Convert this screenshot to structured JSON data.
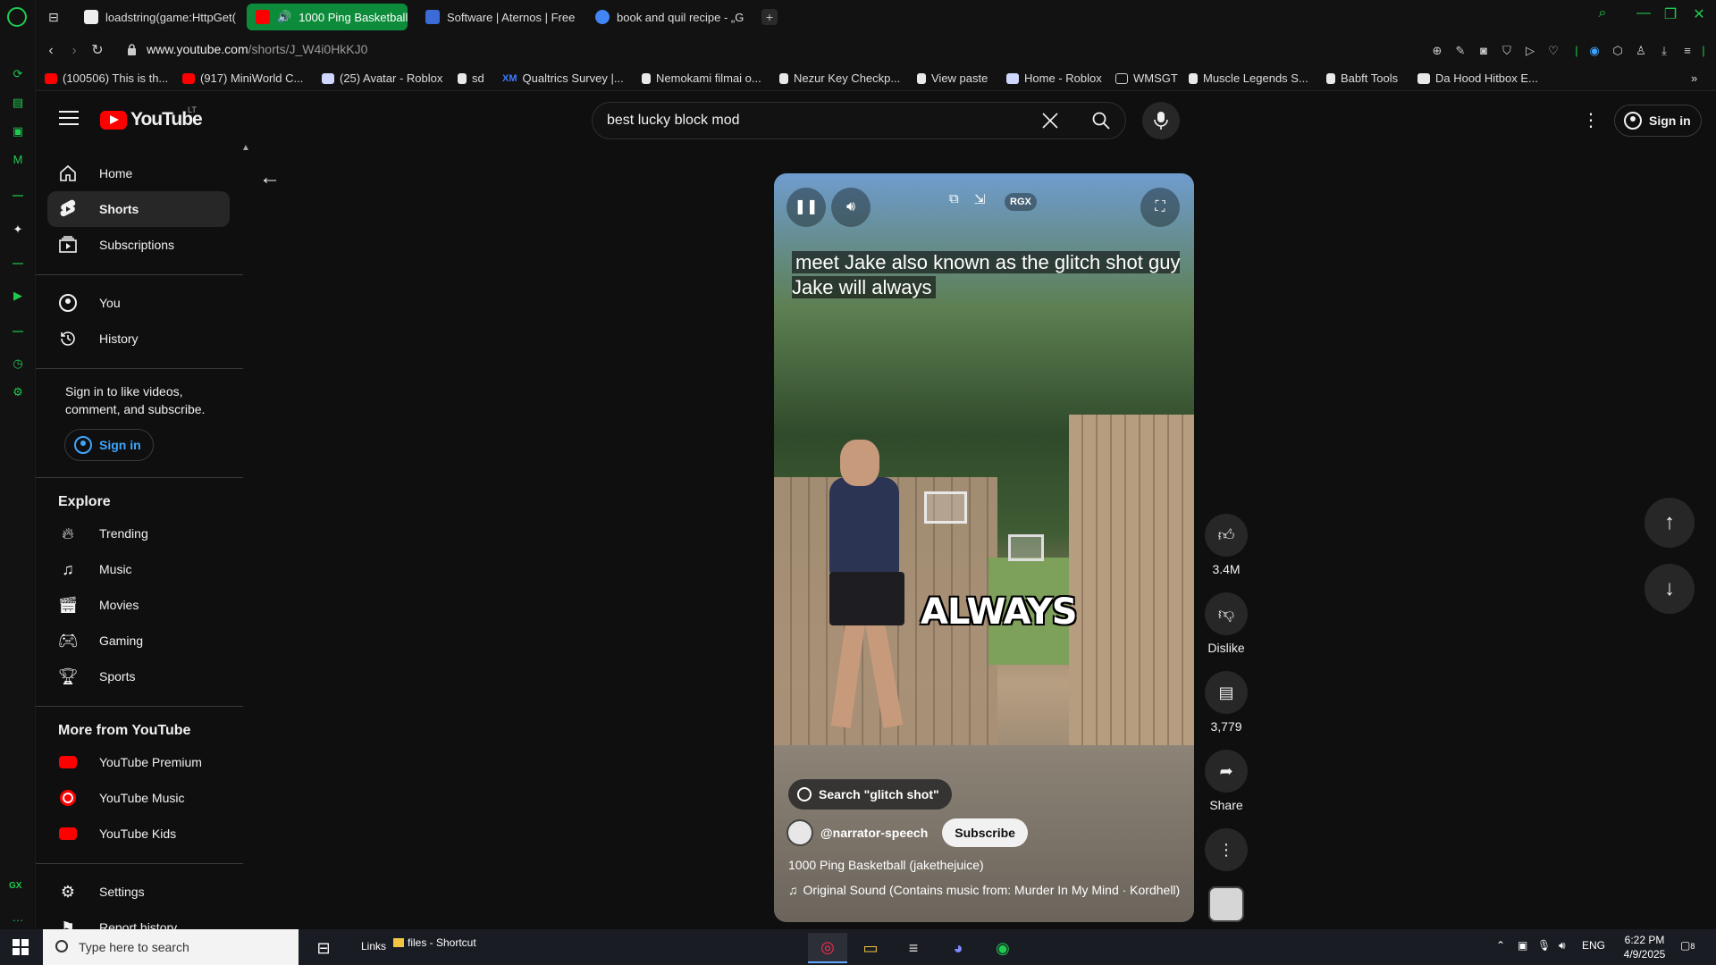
{
  "browser": {
    "tabs": [
      {
        "label": "loadstring(game:HttpGet(",
        "color": "#eeeeee"
      },
      {
        "label": "1000 Ping Basketball (",
        "color": "#ff0000",
        "active": true
      },
      {
        "label": "Software | Aternos | Free",
        "color": "#3b6bd6"
      },
      {
        "label": "book and quil recipe - „G",
        "color": "#4285f4"
      }
    ],
    "tab_add": "+",
    "url_host": "www.youtube.com",
    "url_path": "/shorts/J_W4i0HkKJ0",
    "bookmarks": [
      {
        "label": "(100506) This is th...",
        "color": "#ff0000"
      },
      {
        "label": "(917) MiniWorld C...",
        "color": "#ff0000"
      },
      {
        "label": "(25) Avatar - Roblox",
        "color": "#cfd7ff"
      },
      {
        "label": "sd",
        "color": "#e9e9e9"
      },
      {
        "label": "Qualtrics Survey |...",
        "color": "#1f5bd1",
        "prefix": "XM"
      },
      {
        "label": "Nemokami filmai o...",
        "color": "#e9e9e9"
      },
      {
        "label": "Nezur Key Checkp...",
        "color": "#e9e9e9"
      },
      {
        "label": "View paste",
        "color": "#e9e9e9"
      },
      {
        "label": "Home - Roblox",
        "color": "#cfd7ff"
      },
      {
        "label": "WMSGT",
        "color": "#cccccc"
      },
      {
        "label": "Muscle Legends S...",
        "color": "#e9e9e9"
      },
      {
        "label": "Babft Tools",
        "color": "#e9e9e9"
      },
      {
        "label": "Da Hood Hitbox E...",
        "color": "#e9e9e9"
      }
    ],
    "gx_label": "GX"
  },
  "youtube": {
    "country": "LT",
    "logo_text": "YouTube",
    "search_value": "best lucky block mod",
    "signin_label": "Sign in",
    "sidebar": {
      "main": [
        {
          "label": "Home",
          "icon": "home-icon"
        },
        {
          "label": "Shorts",
          "icon": "shorts-icon"
        },
        {
          "label": "Subscriptions",
          "icon": "subscriptions-icon"
        }
      ],
      "you": [
        {
          "label": "You",
          "icon": "you-icon"
        },
        {
          "label": "History",
          "icon": "history-icon"
        }
      ],
      "signin_msg": "Sign in to like videos, comment, and subscribe.",
      "signin_label": "Sign in",
      "explore_title": "Explore",
      "explore": [
        {
          "label": "Trending",
          "icon": "trending-icon"
        },
        {
          "label": "Music",
          "icon": "music-icon"
        },
        {
          "label": "Movies",
          "icon": "movies-icon"
        },
        {
          "label": "Gaming",
          "icon": "gaming-icon"
        },
        {
          "label": "Sports",
          "icon": "sports-icon"
        }
      ],
      "more_title": "More from YouTube",
      "more": [
        {
          "label": "YouTube Premium",
          "icon": "youtube-premium-icon"
        },
        {
          "label": "YouTube Music",
          "icon": "youtube-music-icon"
        },
        {
          "label": "YouTube Kids",
          "icon": "youtube-kids-icon"
        }
      ],
      "settings_label": "Settings",
      "report_label": "Report history"
    },
    "short": {
      "caption": "meet Jake also known as the glitch shot guy Jake will always",
      "overlay_word": "ALWAYS",
      "rgx_label": "RGX",
      "search_chip": "Search \"glitch shot\"",
      "channel": "@narrator-speech",
      "subscribe_label": "Subscribe",
      "title": "1000 Ping Basketball (jakethejuice)",
      "music": "Original Sound (Contains music from: Murder In My Mind · Kordhell)"
    },
    "actions": {
      "like_count": "3.4M",
      "dislike_label": "Dislike",
      "comment_count": "3,779",
      "share_label": "Share"
    }
  },
  "taskbar": {
    "search_placeholder": "Type here to search",
    "links_label": "Links",
    "files_label": "files - Shortcut",
    "lang": "ENG",
    "time": "6:22 PM",
    "date": "4/9/2025",
    "notifications": "8"
  }
}
